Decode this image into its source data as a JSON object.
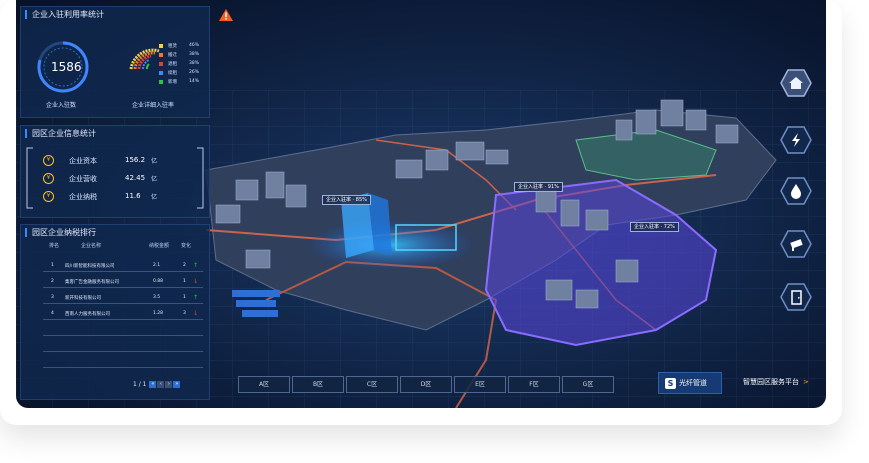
{
  "panel_usage": {
    "title": "企业入驻利用率统计",
    "count_value": "1586",
    "count_label": "企业入驻数",
    "rate_label": "企业详细入驻率",
    "legend": [
      {
        "name": "租赁",
        "pct": "46%",
        "color": "#f2d04a"
      },
      {
        "name": "搬迁",
        "pct": "38%",
        "color": "#ef7a2a"
      },
      {
        "name": "退租",
        "pct": "38%",
        "color": "#e0412f"
      },
      {
        "name": "续租",
        "pct": "26%",
        "color": "#3f86ff"
      },
      {
        "name": "新增",
        "pct": "14%",
        "color": "#2ec24b"
      }
    ]
  },
  "panel_info": {
    "title": "园区企业信息统计",
    "rows": [
      {
        "label": "企业资本",
        "value": "156.2",
        "unit": "亿"
      },
      {
        "label": "企业营收",
        "value": "42.45",
        "unit": "亿"
      },
      {
        "label": "企业纳税",
        "value": "11.6",
        "unit": "亿"
      }
    ]
  },
  "panel_rank": {
    "title": "园区企业纳税排行",
    "headers": {
      "rank": "排名",
      "name": "企业名称",
      "amount": "纳税金额",
      "change": "变化"
    },
    "rows": [
      {
        "rank": "1",
        "name": "四川新智能科技有限公司",
        "amount": "2.1",
        "change": "2",
        "trend": "up"
      },
      {
        "rank": "2",
        "name": "集客广告金融服务有限公司",
        "amount": "0.88",
        "change": "1",
        "trend": "down"
      },
      {
        "rank": "3",
        "name": "新开科技有限公司",
        "amount": "3.5",
        "change": "1",
        "trend": "up"
      },
      {
        "rank": "4",
        "name": "西南人力服务有限公司",
        "amount": "1.28",
        "change": "3",
        "trend": "down"
      }
    ],
    "pager": {
      "text": "1 / 1"
    }
  },
  "zones": [
    "A区",
    "B区",
    "C区",
    "D区",
    "E区",
    "F区",
    "G区"
  ],
  "map_labels": [
    {
      "text": "企业入驻率 · 85%"
    },
    {
      "text": "企业入驻率 · 91%"
    },
    {
      "text": "企业入驻率 · 72%"
    }
  ],
  "fiber_label": "光纤管道",
  "platform_label": "智慧园区服务平台",
  "platform_arrow": ">",
  "colors": {
    "accent": "#2e8cff",
    "warning": "#ff5a1f",
    "gold": "#ffc21c",
    "up": "#2ec24b",
    "down": "#e0412f"
  },
  "icons": {
    "warning": "warning-icon",
    "nav": [
      "home-icon",
      "lightning-icon",
      "water-drop-icon",
      "camera-icon",
      "door-icon"
    ]
  }
}
